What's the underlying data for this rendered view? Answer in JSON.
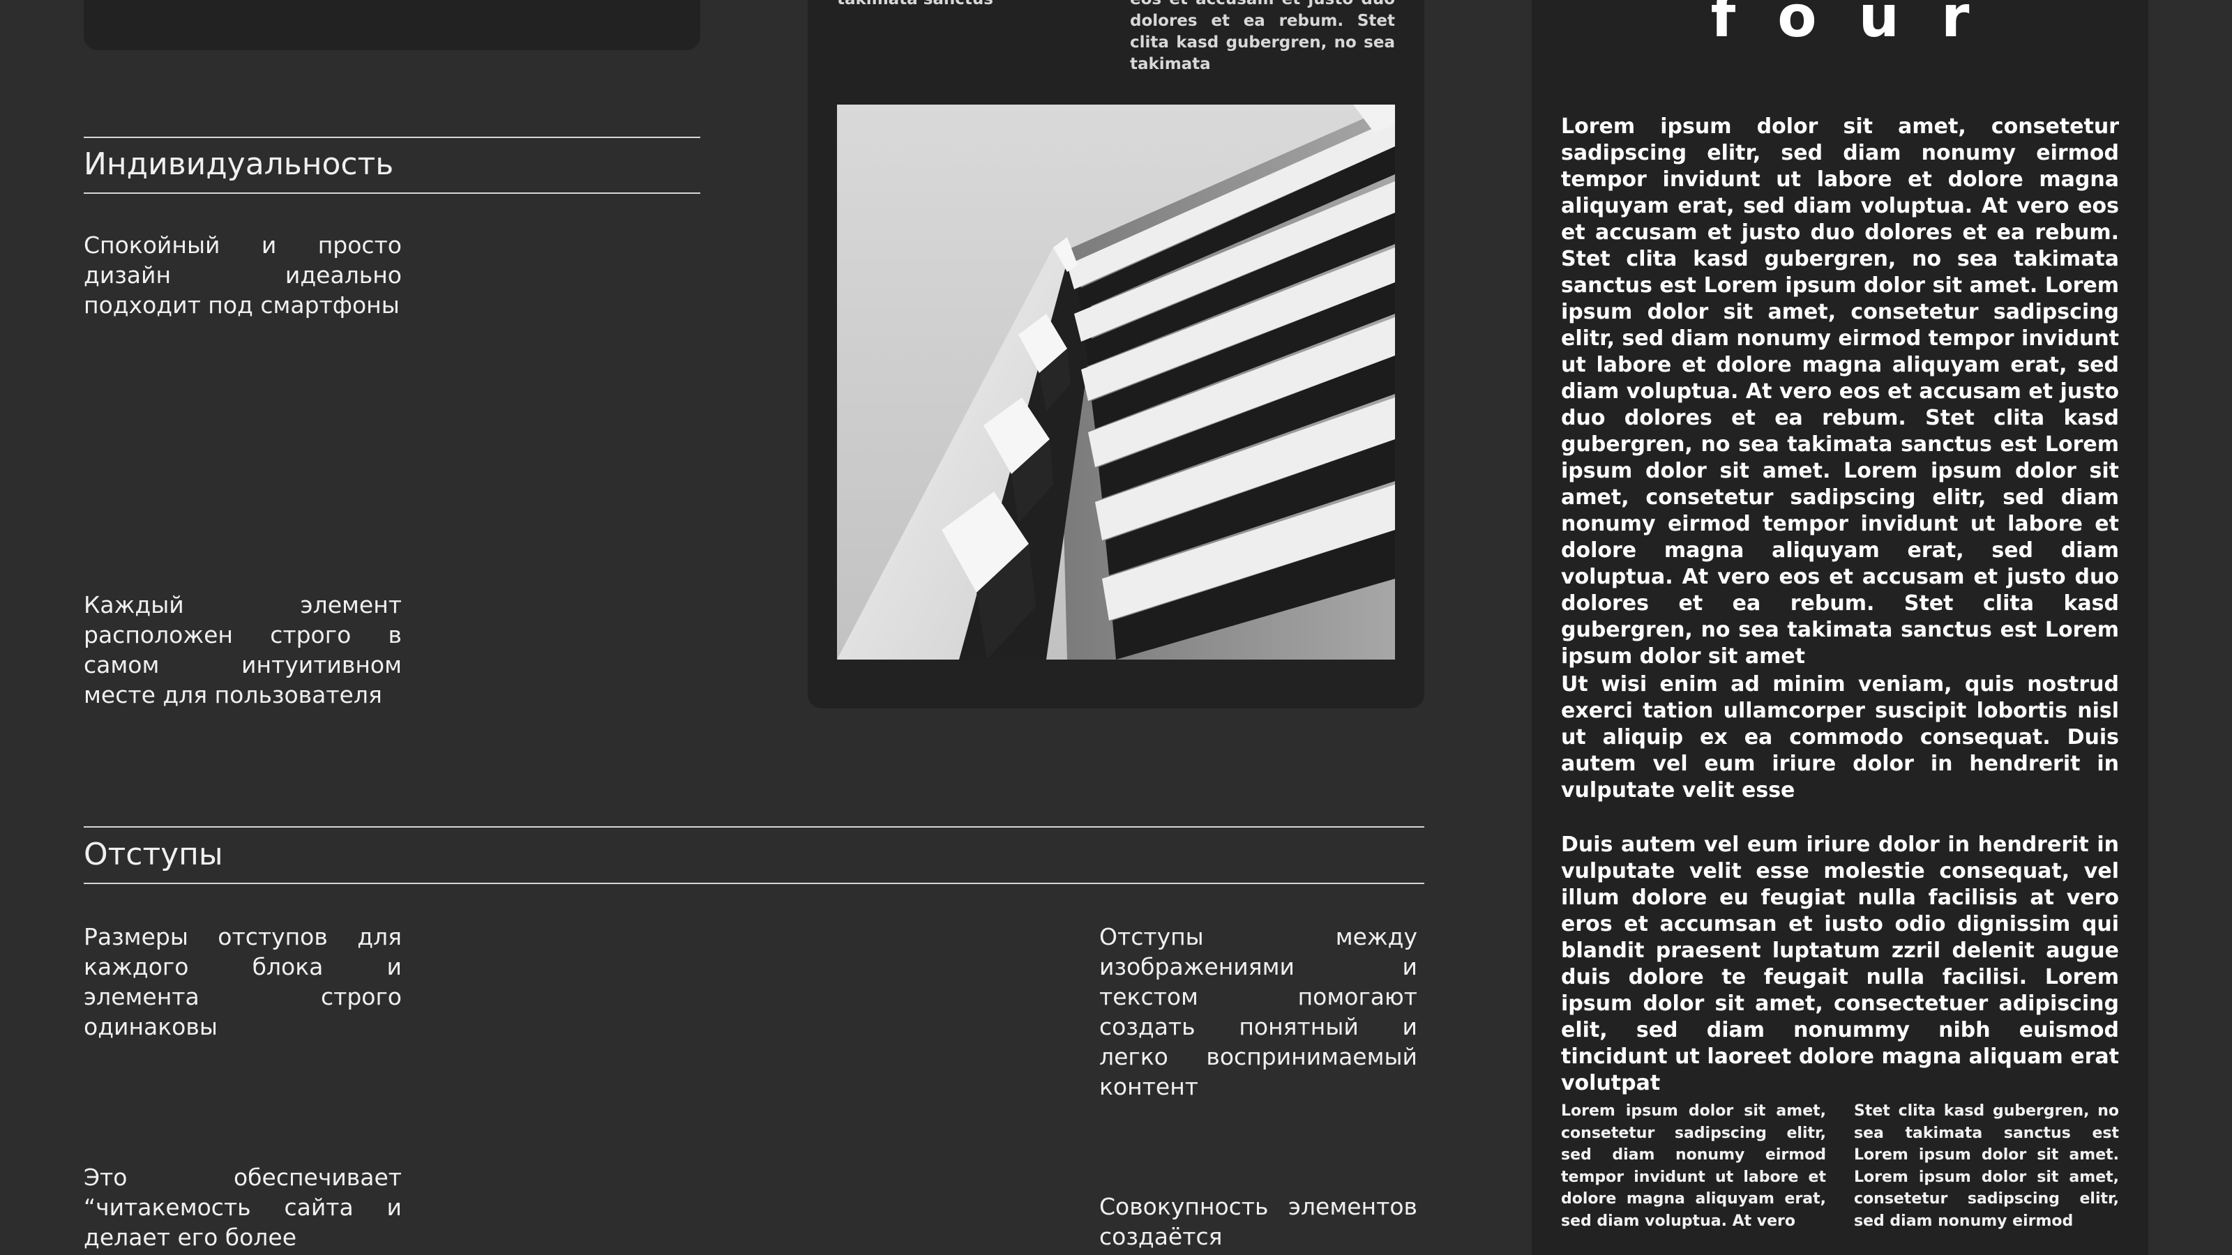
{
  "caption_left": "takimata sanctus",
  "caption_right": "eos et accusam et justo duo dolores et ea rebum. Stet clita kasd gubergren, no sea takimata",
  "photo_icon": "building-photo",
  "section_individuality": {
    "title": "Индивидуальность",
    "feature1": "Спокойный и просто дизайн идеально подходит под смартфоны",
    "feature2": "Каждый элемент расположен строго в самом интуитивном месте для пользователя"
  },
  "section_spacing": {
    "title": "Отступы",
    "feature1": "Размеры отступов для каждого блока и элемента строго одинаковы",
    "feature2": "Это обеспечивает “читакемость сайта и делает его более",
    "feature3": "Отступы между изображениями и текстом помогают создать понятный и легко воспринимаемый контент",
    "feature4": "Совокупность элементов создаётся"
  },
  "panel": {
    "heading": "four",
    "para1": "Lorem ipsum dolor sit amet, consetetur sadipscing elitr, sed diam nonumy eirmod tempor invidunt ut labore et dolore magna aliquyam erat, sed diam voluptua. At vero eos et accusam et justo duo dolores et ea rebum. Stet clita kasd gubergren, no sea takimata sanctus est Lorem ipsum dolor sit amet. Lorem ipsum dolor sit amet, consetetur sadipscing elitr, sed diam nonumy eirmod tempor invidunt ut labore et dolore magna aliquyam erat, sed diam voluptua. At vero eos et accusam et justo duo dolores et ea rebum. Stet clita kasd gubergren, no sea takimata sanctus est Lorem ipsum dolor sit amet. Lorem ipsum dolor sit amet, consetetur sadipscing elitr, sed diam nonumy eirmod tempor invidunt ut labore et dolore magna aliquyam erat, sed diam voluptua. At vero eos et accusam et justo duo dolores et ea rebum. Stet clita kasd gubergren, no sea takimata sanctus est Lorem ipsum dolor sit amet",
    "para2": "Ut wisi enim ad minim veniam, quis nostrud exerci tation ullamcorper suscipit lobortis nisl ut aliquip ex ea commodo consequat. Duis autem vel eum iriure dolor in hendrerit in vulputate velit esse",
    "para3": "Duis autem vel eum iriure dolor in hendrerit in vulputate velit esse molestie consequat, vel illum dolore eu feugiat nulla facilisis at vero eros et accumsan et iusto odio dignissim qui blandit praesent luptatum zzril delenit augue duis dolore te feugait nulla facilisi. Lorem ipsum dolor sit amet, consectetuer adipiscing elit, sed diam nonummy nibh euismod tincidunt ut laoreet dolore magna aliquam erat volutpat",
    "small_left": "Lorem ipsum dolor sit amet, consetetur sadipscing elitr, sed diam nonumy eirmod tempor invidunt ut labore et dolore magna aliquyam erat, sed diam voluptua. At vero",
    "small_right": "Stet clita kasd gubergren, no sea takimata sanctus est Lorem ipsum dolor sit amet. Lorem ipsum dolor sit amet, consetetur sadipscing elitr, sed diam nonumy eirmod"
  }
}
